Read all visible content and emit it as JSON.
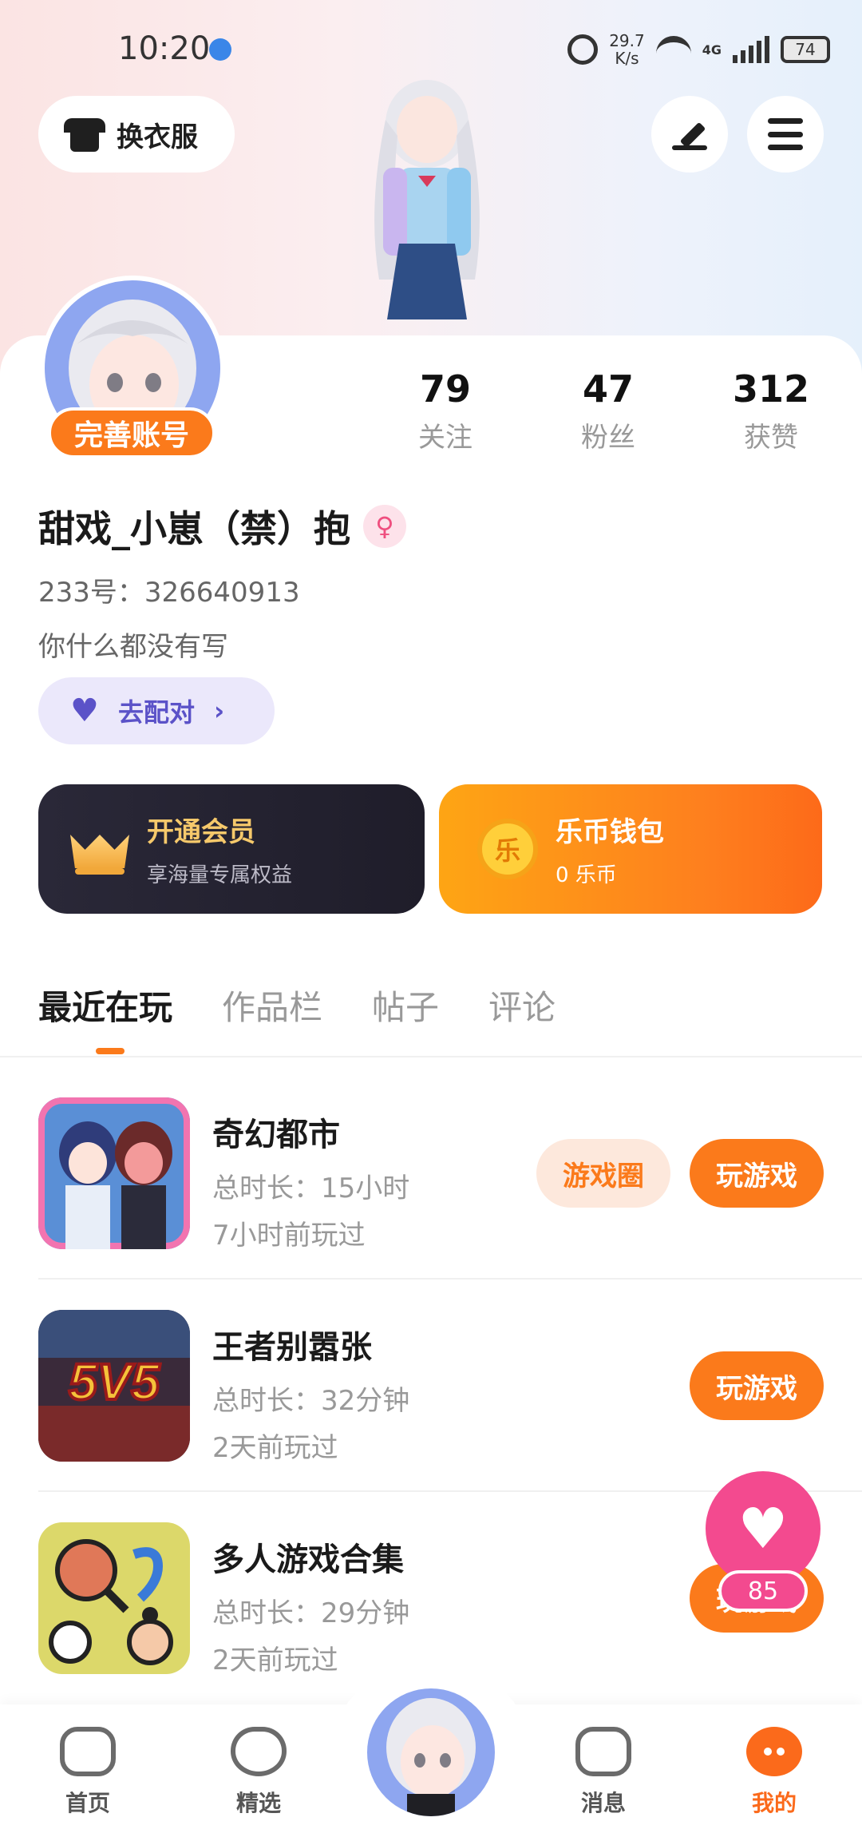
{
  "status_bar": {
    "time": "10:20",
    "net_speed_value": "29.7",
    "net_speed_unit": "K/s",
    "network": "4G",
    "battery": "74"
  },
  "header": {
    "outfit_label": "换衣服",
    "edit_icon": "pen-icon",
    "menu_icon": "menu-icon"
  },
  "profile": {
    "complete_badge": "完善账号",
    "username": "甜戏_小崽（禁）抱",
    "gender_symbol": "♀",
    "uid": "233号：326640913",
    "bio": "你什么都没有写",
    "match_label": "去配对",
    "stats": [
      {
        "value": "79",
        "label": "关注"
      },
      {
        "value": "47",
        "label": "粉丝"
      },
      {
        "value": "312",
        "label": "获赞"
      }
    ]
  },
  "cards": {
    "vip": {
      "title": "开通会员",
      "subtitle": "享海量专属权益"
    },
    "wallet": {
      "coin_glyph": "乐",
      "title": "乐币钱包",
      "subtitle": "0 乐币"
    }
  },
  "tabs": [
    "最近在玩",
    "作品栏",
    "帖子",
    "评论"
  ],
  "games": [
    {
      "name": "奇幻都市",
      "duration": "总时长：15小时",
      "last_played": "7小时前玩过",
      "circle_label": "游戏圈",
      "play_label": "玩游戏"
    },
    {
      "name": "王者别嚣张",
      "duration": "总时长：32分钟",
      "last_played": "2天前玩过",
      "thumb_text": "5V5",
      "play_label": "玩游戏"
    },
    {
      "name": "多人游戏合集",
      "duration": "总时长：29分钟",
      "last_played": "2天前玩过",
      "play_label": "玩游戏"
    }
  ],
  "floating": {
    "count": "85"
  },
  "bottom_nav": [
    {
      "label": "首页",
      "icon": "gamepad-icon"
    },
    {
      "label": "精选",
      "icon": "heart-icon"
    },
    {
      "label": "消息",
      "icon": "chat-icon"
    },
    {
      "label": "我的",
      "icon": "me-icon"
    }
  ],
  "colors": {
    "accent": "#fb7a1b",
    "vip_gold": "#f6c96b",
    "pink": "#f34a8f",
    "purple": "#5b52c8"
  }
}
